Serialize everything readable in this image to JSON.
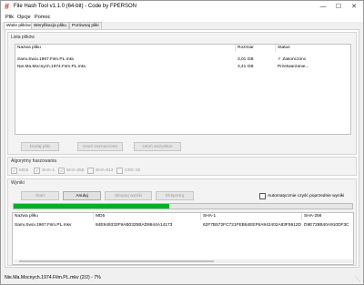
{
  "window": {
    "title": "File Hash Tool v1.1.0 (64-bit) - Code by FPERSON",
    "minimize_icon": "minimize-icon",
    "maximize_icon": "maximize-icon",
    "close_icon": "close-icon",
    "app_icon_glyph": "#"
  },
  "menu": [
    "Plik",
    "Opcje",
    "Pomoc"
  ],
  "tabs": [
    {
      "label": "Wiele plików",
      "active": true
    },
    {
      "label": "Weryfikacja pliku",
      "active": false
    },
    {
      "label": "Porównaj pliki",
      "active": false
    }
  ],
  "file_list": {
    "group_label": "Lista plików",
    "columns": [
      "Nazwa pliku",
      "Rozmiar",
      "Status"
    ],
    "rows": [
      {
        "name": "Sami.Swoi.1967.Film.PL.mkv",
        "size": "3,01 GB",
        "status": "✓ Zakończono"
      },
      {
        "name": "Nie.Ma.Mocnych.1974.Film.PL.mkv",
        "size": "3,41 GB",
        "status": "Przetwarzanie..."
      }
    ],
    "buttons": [
      "Dodaj pliki",
      "Usuń zaznaczone",
      "Usuń wszystkie"
    ]
  },
  "algorithms": {
    "group_label": "Algorytmy haszowania",
    "items": [
      {
        "label": "MD5",
        "checked": true
      },
      {
        "label": "SHA-1",
        "checked": true
      },
      {
        "label": "SHA-256",
        "checked": true
      },
      {
        "label": "SHA-512",
        "checked": false
      },
      {
        "label": "CRC-32",
        "checked": false
      }
    ]
  },
  "results": {
    "group_label": "Wyniki",
    "buttons": [
      {
        "label": "Start",
        "enabled": false
      },
      {
        "label": "Anuluj",
        "enabled": true
      },
      {
        "label": "Skopiuj wyniki",
        "enabled": false
      },
      {
        "label": "Eksportuj",
        "enabled": false
      }
    ],
    "auto_clear_label": "Automatycznie czyść poprzednie wyniki",
    "auto_clear_checked": false,
    "progress": 0.46,
    "progress_color": "#06b025",
    "columns": [
      "Nazwa pliku",
      "MD5",
      "SHA-1",
      "SHA-256"
    ],
    "rows": [
      {
        "name": "Sami.Swoi.1967.Film.PL.mkv",
        "md5": "84E949332F9AB0325BAD8644A14173",
        "sha1": "62F7B572FC721FEB64EEF6A942402A83F5912D11",
        "sha256": "D9E728B40A910DF3C"
      }
    ]
  },
  "status_text": "Nie.Ma.Mocnych.1974.Film.PL.mkv (2/2) - 7%"
}
